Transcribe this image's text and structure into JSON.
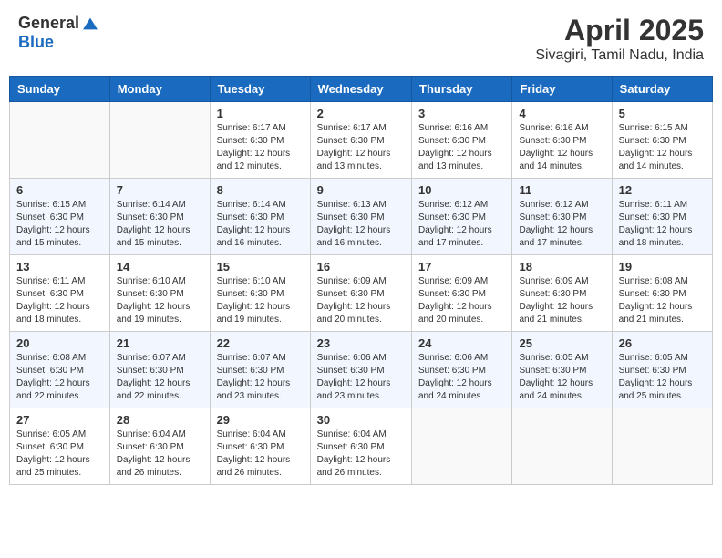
{
  "header": {
    "logo_general": "General",
    "logo_blue": "Blue",
    "title": "April 2025",
    "subtitle": "Sivagiri, Tamil Nadu, India"
  },
  "days_of_week": [
    "Sunday",
    "Monday",
    "Tuesday",
    "Wednesday",
    "Thursday",
    "Friday",
    "Saturday"
  ],
  "weeks": [
    [
      {
        "day": "",
        "sunrise": "",
        "sunset": "",
        "daylight": ""
      },
      {
        "day": "",
        "sunrise": "",
        "sunset": "",
        "daylight": ""
      },
      {
        "day": "1",
        "sunrise": "Sunrise: 6:17 AM",
        "sunset": "Sunset: 6:30 PM",
        "daylight": "Daylight: 12 hours and 12 minutes."
      },
      {
        "day": "2",
        "sunrise": "Sunrise: 6:17 AM",
        "sunset": "Sunset: 6:30 PM",
        "daylight": "Daylight: 12 hours and 13 minutes."
      },
      {
        "day": "3",
        "sunrise": "Sunrise: 6:16 AM",
        "sunset": "Sunset: 6:30 PM",
        "daylight": "Daylight: 12 hours and 13 minutes."
      },
      {
        "day": "4",
        "sunrise": "Sunrise: 6:16 AM",
        "sunset": "Sunset: 6:30 PM",
        "daylight": "Daylight: 12 hours and 14 minutes."
      },
      {
        "day": "5",
        "sunrise": "Sunrise: 6:15 AM",
        "sunset": "Sunset: 6:30 PM",
        "daylight": "Daylight: 12 hours and 14 minutes."
      }
    ],
    [
      {
        "day": "6",
        "sunrise": "Sunrise: 6:15 AM",
        "sunset": "Sunset: 6:30 PM",
        "daylight": "Daylight: 12 hours and 15 minutes."
      },
      {
        "day": "7",
        "sunrise": "Sunrise: 6:14 AM",
        "sunset": "Sunset: 6:30 PM",
        "daylight": "Daylight: 12 hours and 15 minutes."
      },
      {
        "day": "8",
        "sunrise": "Sunrise: 6:14 AM",
        "sunset": "Sunset: 6:30 PM",
        "daylight": "Daylight: 12 hours and 16 minutes."
      },
      {
        "day": "9",
        "sunrise": "Sunrise: 6:13 AM",
        "sunset": "Sunset: 6:30 PM",
        "daylight": "Daylight: 12 hours and 16 minutes."
      },
      {
        "day": "10",
        "sunrise": "Sunrise: 6:12 AM",
        "sunset": "Sunset: 6:30 PM",
        "daylight": "Daylight: 12 hours and 17 minutes."
      },
      {
        "day": "11",
        "sunrise": "Sunrise: 6:12 AM",
        "sunset": "Sunset: 6:30 PM",
        "daylight": "Daylight: 12 hours and 17 minutes."
      },
      {
        "day": "12",
        "sunrise": "Sunrise: 6:11 AM",
        "sunset": "Sunset: 6:30 PM",
        "daylight": "Daylight: 12 hours and 18 minutes."
      }
    ],
    [
      {
        "day": "13",
        "sunrise": "Sunrise: 6:11 AM",
        "sunset": "Sunset: 6:30 PM",
        "daylight": "Daylight: 12 hours and 18 minutes."
      },
      {
        "day": "14",
        "sunrise": "Sunrise: 6:10 AM",
        "sunset": "Sunset: 6:30 PM",
        "daylight": "Daylight: 12 hours and 19 minutes."
      },
      {
        "day": "15",
        "sunrise": "Sunrise: 6:10 AM",
        "sunset": "Sunset: 6:30 PM",
        "daylight": "Daylight: 12 hours and 19 minutes."
      },
      {
        "day": "16",
        "sunrise": "Sunrise: 6:09 AM",
        "sunset": "Sunset: 6:30 PM",
        "daylight": "Daylight: 12 hours and 20 minutes."
      },
      {
        "day": "17",
        "sunrise": "Sunrise: 6:09 AM",
        "sunset": "Sunset: 6:30 PM",
        "daylight": "Daylight: 12 hours and 20 minutes."
      },
      {
        "day": "18",
        "sunrise": "Sunrise: 6:09 AM",
        "sunset": "Sunset: 6:30 PM",
        "daylight": "Daylight: 12 hours and 21 minutes."
      },
      {
        "day": "19",
        "sunrise": "Sunrise: 6:08 AM",
        "sunset": "Sunset: 6:30 PM",
        "daylight": "Daylight: 12 hours and 21 minutes."
      }
    ],
    [
      {
        "day": "20",
        "sunrise": "Sunrise: 6:08 AM",
        "sunset": "Sunset: 6:30 PM",
        "daylight": "Daylight: 12 hours and 22 minutes."
      },
      {
        "day": "21",
        "sunrise": "Sunrise: 6:07 AM",
        "sunset": "Sunset: 6:30 PM",
        "daylight": "Daylight: 12 hours and 22 minutes."
      },
      {
        "day": "22",
        "sunrise": "Sunrise: 6:07 AM",
        "sunset": "Sunset: 6:30 PM",
        "daylight": "Daylight: 12 hours and 23 minutes."
      },
      {
        "day": "23",
        "sunrise": "Sunrise: 6:06 AM",
        "sunset": "Sunset: 6:30 PM",
        "daylight": "Daylight: 12 hours and 23 minutes."
      },
      {
        "day": "24",
        "sunrise": "Sunrise: 6:06 AM",
        "sunset": "Sunset: 6:30 PM",
        "daylight": "Daylight: 12 hours and 24 minutes."
      },
      {
        "day": "25",
        "sunrise": "Sunrise: 6:05 AM",
        "sunset": "Sunset: 6:30 PM",
        "daylight": "Daylight: 12 hours and 24 minutes."
      },
      {
        "day": "26",
        "sunrise": "Sunrise: 6:05 AM",
        "sunset": "Sunset: 6:30 PM",
        "daylight": "Daylight: 12 hours and 25 minutes."
      }
    ],
    [
      {
        "day": "27",
        "sunrise": "Sunrise: 6:05 AM",
        "sunset": "Sunset: 6:30 PM",
        "daylight": "Daylight: 12 hours and 25 minutes."
      },
      {
        "day": "28",
        "sunrise": "Sunrise: 6:04 AM",
        "sunset": "Sunset: 6:30 PM",
        "daylight": "Daylight: 12 hours and 26 minutes."
      },
      {
        "day": "29",
        "sunrise": "Sunrise: 6:04 AM",
        "sunset": "Sunset: 6:30 PM",
        "daylight": "Daylight: 12 hours and 26 minutes."
      },
      {
        "day": "30",
        "sunrise": "Sunrise: 6:04 AM",
        "sunset": "Sunset: 6:30 PM",
        "daylight": "Daylight: 12 hours and 26 minutes."
      },
      {
        "day": "",
        "sunrise": "",
        "sunset": "",
        "daylight": ""
      },
      {
        "day": "",
        "sunrise": "",
        "sunset": "",
        "daylight": ""
      },
      {
        "day": "",
        "sunrise": "",
        "sunset": "",
        "daylight": ""
      }
    ]
  ]
}
